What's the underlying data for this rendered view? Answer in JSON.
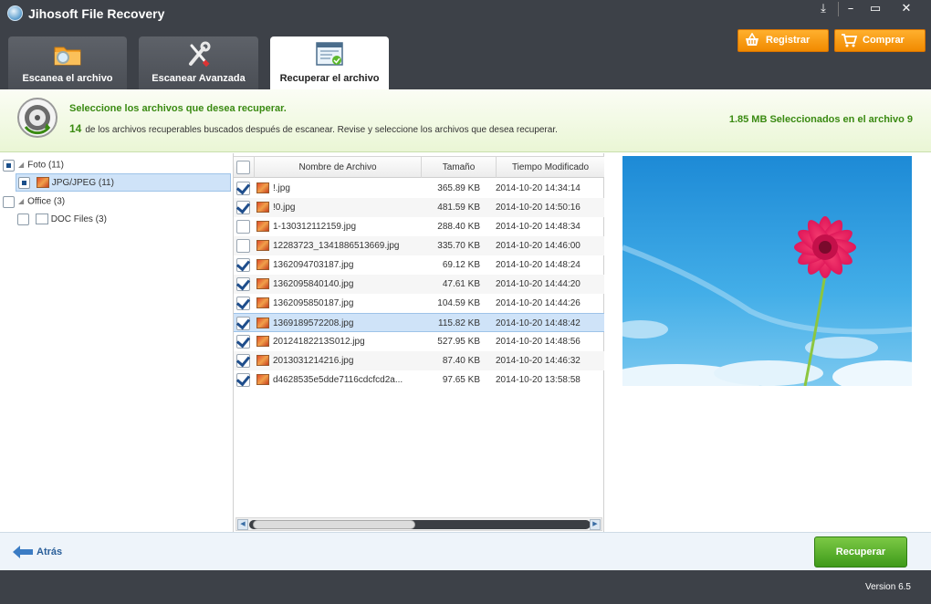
{
  "window": {
    "title": "Jihosoft File Recovery",
    "controls": [
      "⤓",
      "–",
      "▭",
      "✕"
    ]
  },
  "header_buttons": {
    "register_label": "Registrar",
    "buy_label": "Comprar"
  },
  "tabs": [
    {
      "label": "Escanea el archivo",
      "icon": "folder-magnifier-icon",
      "active": false
    },
    {
      "label": "Escanear Avanzada",
      "icon": "tools-icon",
      "active": false
    },
    {
      "label": "Recuperar el archivo",
      "icon": "recover-window-icon",
      "active": true
    }
  ],
  "banner": {
    "title": "Seleccione los archivos que desea recuperar.",
    "count": "14",
    "description": "de los archivos recuperables buscados después de escanear. Revise y seleccione los archivos que desea recuperar.",
    "selected_info": "1.85 MB Seleccionados en el archivo 9"
  },
  "tree": [
    {
      "label": "Foto (11)",
      "level": 0,
      "state": "partial"
    },
    {
      "label": "JPG/JPEG (11)",
      "level": 1,
      "state": "partial",
      "selected": true
    },
    {
      "label": "Office (3)",
      "level": 0,
      "state": "unchecked"
    },
    {
      "label": "DOC Files (3)",
      "level": 1,
      "state": "unchecked"
    }
  ],
  "table": {
    "columns": [
      "Nombre de Archivo",
      "Tamaño",
      "Tiempo Modificado"
    ],
    "rows": [
      {
        "name": "!.jpg",
        "size": "365.89 KB",
        "modified": "2014-10-20 14:34:14",
        "checked": true
      },
      {
        "name": "!0.jpg",
        "size": "481.59 KB",
        "modified": "2014-10-20 14:50:16",
        "checked": true
      },
      {
        "name": "1-130312112159.jpg",
        "size": "288.40 KB",
        "modified": "2014-10-20 14:48:34",
        "checked": false
      },
      {
        "name": "12283723_1341886513669.jpg",
        "size": "335.70 KB",
        "modified": "2014-10-20 14:46:00",
        "checked": false
      },
      {
        "name": "1362094703187.jpg",
        "size": "69.12 KB",
        "modified": "2014-10-20 14:48:24",
        "checked": true
      },
      {
        "name": "1362095840140.jpg",
        "size": "47.61 KB",
        "modified": "2014-10-20 14:44:20",
        "checked": true
      },
      {
        "name": "1362095850187.jpg",
        "size": "104.59 KB",
        "modified": "2014-10-20 14:44:26",
        "checked": true
      },
      {
        "name": "1369189572208.jpg",
        "size": "115.82 KB",
        "modified": "2014-10-20 14:48:42",
        "checked": true,
        "selected": true
      },
      {
        "name": "20124182213S012.jpg",
        "size": "527.95 KB",
        "modified": "2014-10-20 14:48:56",
        "checked": true
      },
      {
        "name": "2013031214216.jpg",
        "size": "87.40 KB",
        "modified": "2014-10-20 14:46:32",
        "checked": true
      },
      {
        "name": "d4628535e5dde7116cdcfcd2a...",
        "size": "97.65 KB",
        "modified": "2014-10-20 13:58:58",
        "checked": true
      }
    ]
  },
  "footer": {
    "back_label": "Atrás",
    "recover_label": "Recuperar",
    "version": "Version 6.5"
  },
  "colors": {
    "titlebar": "#3d4148",
    "accent_orange": "#f39a1a",
    "accent_green": "#3a8a12",
    "recover_green": "#4ea524",
    "selection": "#cfe3f8"
  }
}
